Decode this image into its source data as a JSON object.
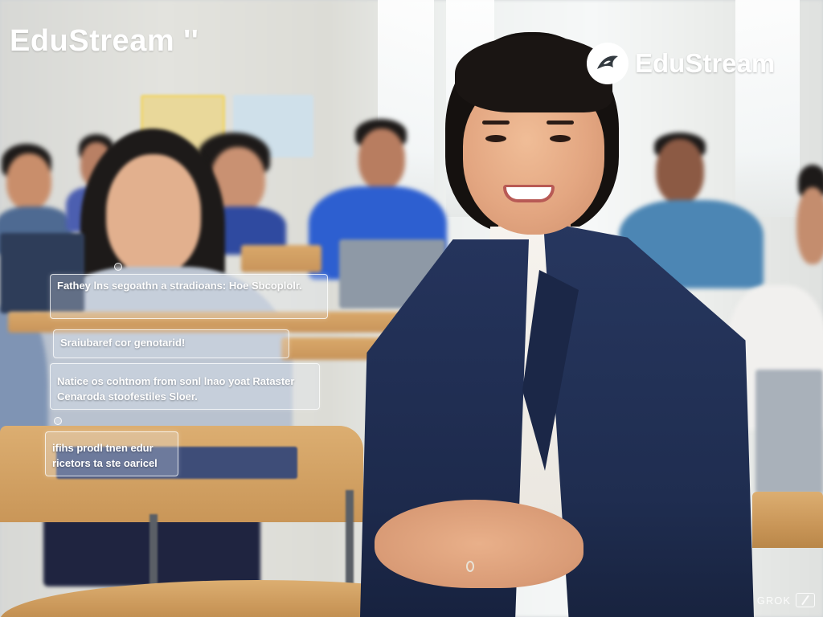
{
  "scene": {
    "description_alt": ""
  },
  "brand": {
    "left_logo_text": "EduStream ''",
    "right_logo_text": "EduStream",
    "badge_icon": "bird-logo-icon"
  },
  "captions": [
    {
      "text": "Fathey lns segoathn a stradioans: Hoe Sbcoplolr."
    },
    {
      "text": "Sraiubaref cor genotarid!"
    },
    {
      "text": "Natice os cohtnom from sonl lnao yoat Rataster Cenaroda stoofestiles Sloer."
    },
    {
      "text": "ifihs prodl tnen edur ricetors ta ste oaricel"
    }
  ],
  "watermark": {
    "label": "GROK",
    "icon": "grok-logo-icon"
  },
  "colors": {
    "jacket": "#1f2d50",
    "desk": "#c99658",
    "panel_border": "#ffffff"
  }
}
